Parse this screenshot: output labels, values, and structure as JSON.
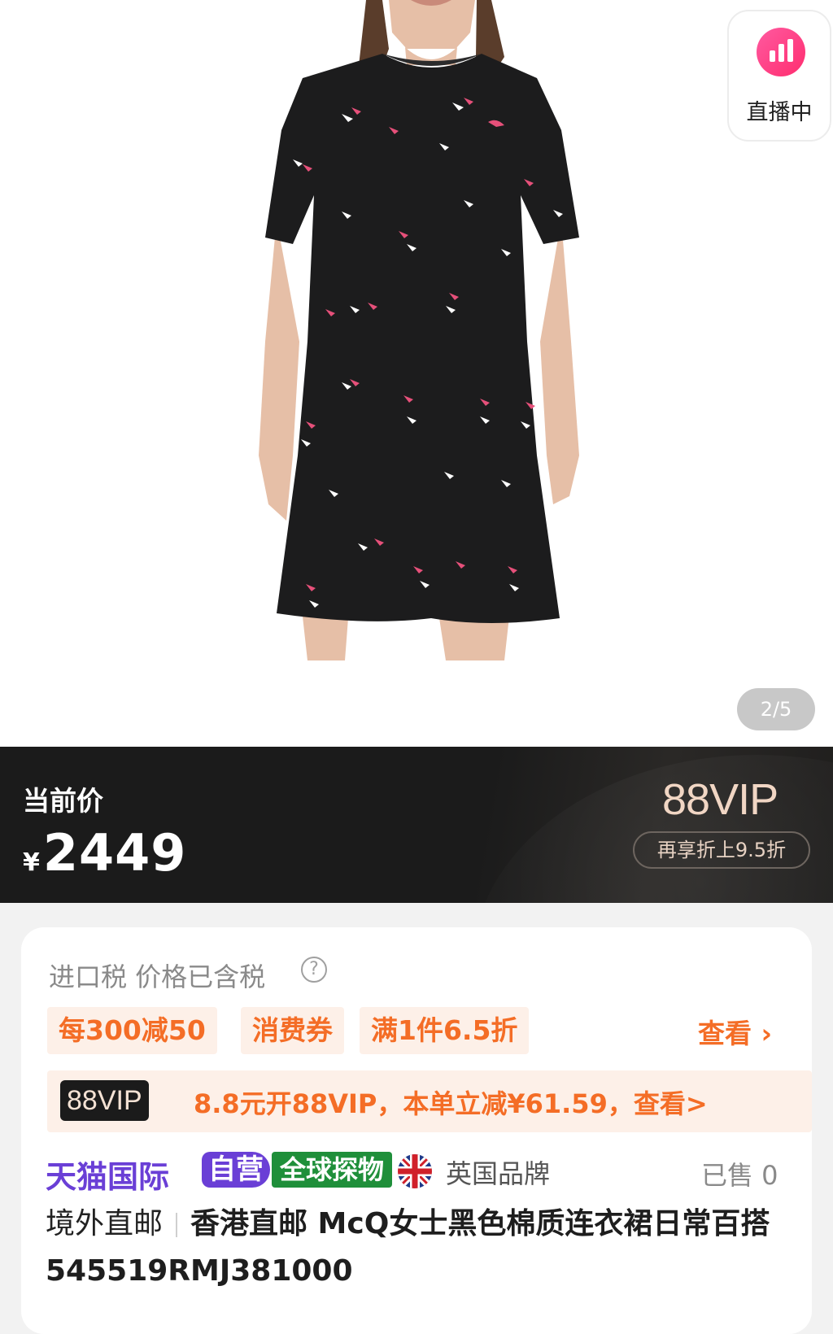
{
  "live": {
    "label": "直播中",
    "icon": "live-bars-icon"
  },
  "gallery": {
    "pager": "2/5"
  },
  "price": {
    "label": "当前价",
    "currency": "¥",
    "value": "2449",
    "vip_logo": "88VIP",
    "vip_discount": "再享折上9.5折"
  },
  "info": {
    "tax_text": "进口税 价格已含税",
    "help_icon": "?",
    "promos": [
      "每300减50",
      "消费券",
      "满1件6.5折"
    ],
    "view_more": "查看 ›",
    "vip_chip": "88VIP",
    "vip_offer": "8.8元开88VIP，本单立减¥61.59，查看>",
    "brand": {
      "tmall": "天猫国际",
      "self_operated": "自营",
      "global": "全球探物",
      "flag_icon": "uk-flag-icon",
      "country_brand": "英国品牌"
    },
    "sold": "已售 0",
    "title_prefix": "境外直邮",
    "title": "香港直邮 McQ女士黑色棉质连衣裙日常百搭 545519RMJ381000"
  },
  "colors": {
    "accent_orange": "#f46d26",
    "tmall_purple": "#6a3fd6",
    "global_green": "#1f8f3a",
    "live_pink": "#ff3d7f",
    "price_band": "#1b1b1b"
  }
}
